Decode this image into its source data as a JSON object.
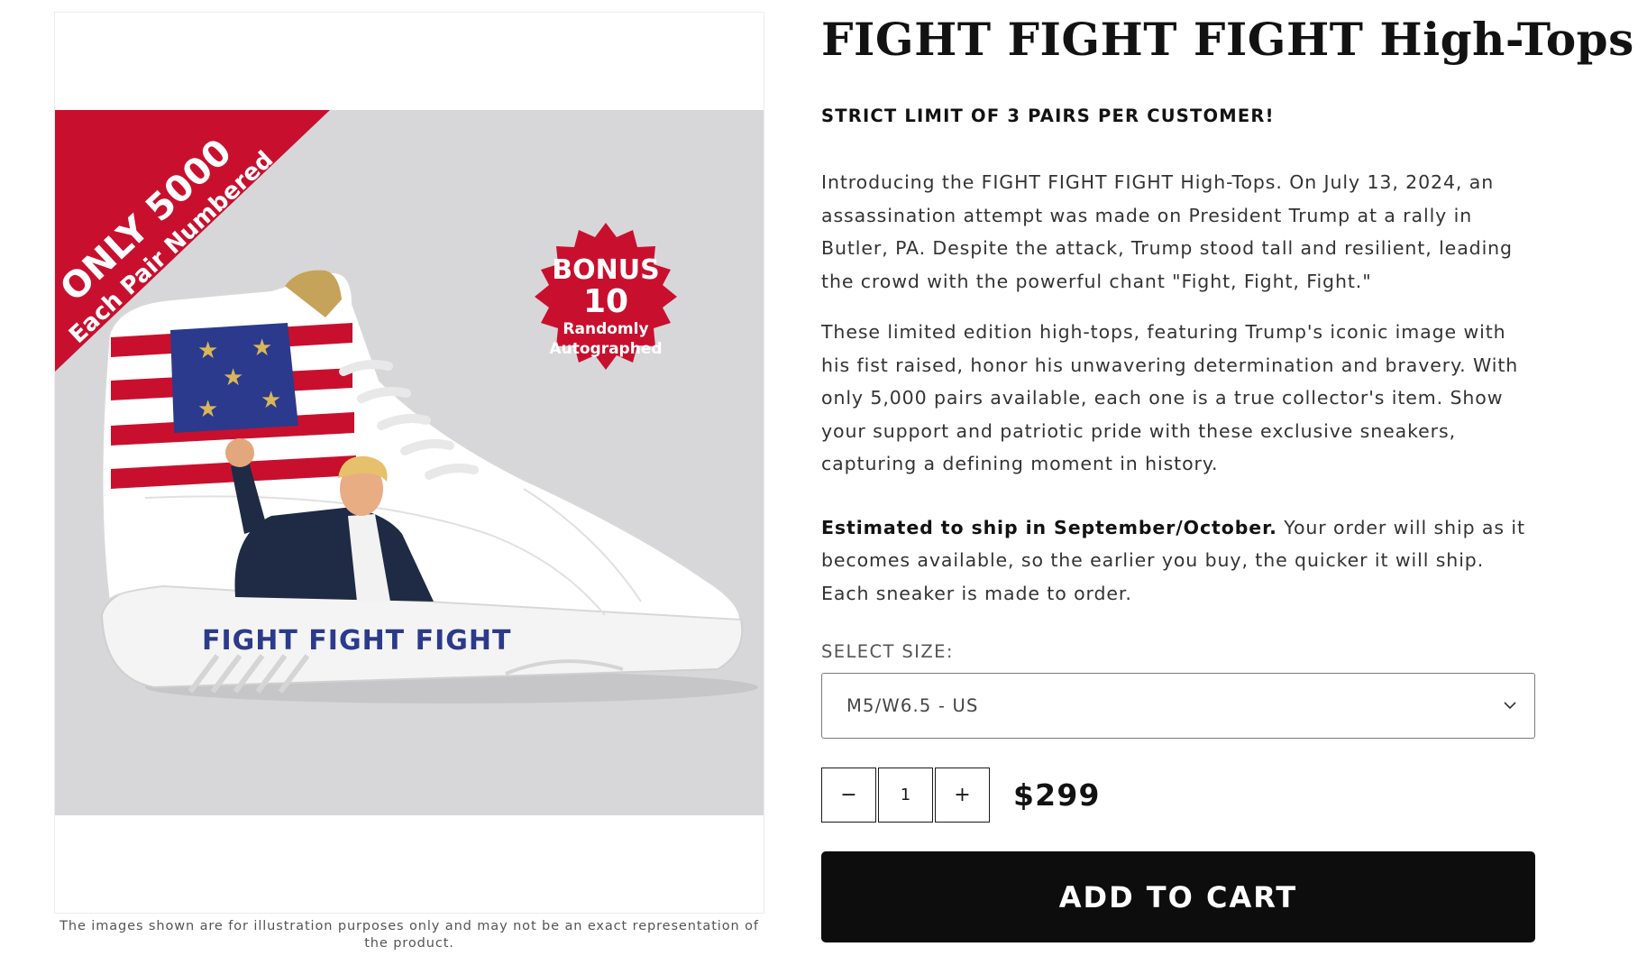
{
  "product": {
    "title": "FIGHT FIGHT FIGHT High-Tops",
    "limit_notice": "STRICT LIMIT OF 3 PAIRS PER CUSTOMER!",
    "description": [
      "Introducing the FIGHT FIGHT FIGHT High-Tops. On July 13, 2024, an assassination attempt was made on President Trump at a rally in Butler, PA. Despite the attack, Trump stood tall and resilient, leading the crowd with the powerful chant \"Fight, Fight, Fight.\"",
      "These limited edition high-tops, featuring Trump's iconic image with his fist raised, honor his unwavering determination and bravery. With only 5,000 pairs available, each one is a true collector's item. Show your support and patriotic pride with these exclusive sneakers, capturing a defining moment in history."
    ],
    "shipping": {
      "bold": "Estimated to ship in September/October.",
      "text": " Your order will ship as it becomes available, so the earlier you buy, the quicker it will ship. Each sneaker is made to order."
    },
    "size": {
      "label": "SELECT SIZE:",
      "selected": "M5/W6.5 - US"
    },
    "quantity": {
      "value": "1",
      "decrement": "−",
      "increment": "+"
    },
    "price": "$299",
    "add_to_cart": "ADD TO CART"
  },
  "gallery": {
    "ribbon_line1": "ONLY 5000",
    "ribbon_line2": "Each Pair Numbered",
    "bonus_line1": "BONUS",
    "bonus_line2": "10",
    "bonus_line3": "Randomly",
    "bonus_line4": "Autographed",
    "shoe_text": "FIGHT FIGHT FIGHT",
    "disclaimer": "The images shown are for illustration purposes only and may not be an exact representation of the product."
  },
  "colors": {
    "ribbon_red": "#c8102e",
    "flag_blue": "#2b3a8c",
    "button_black": "#0d0d0d",
    "image_background": "#d7d7d9"
  }
}
